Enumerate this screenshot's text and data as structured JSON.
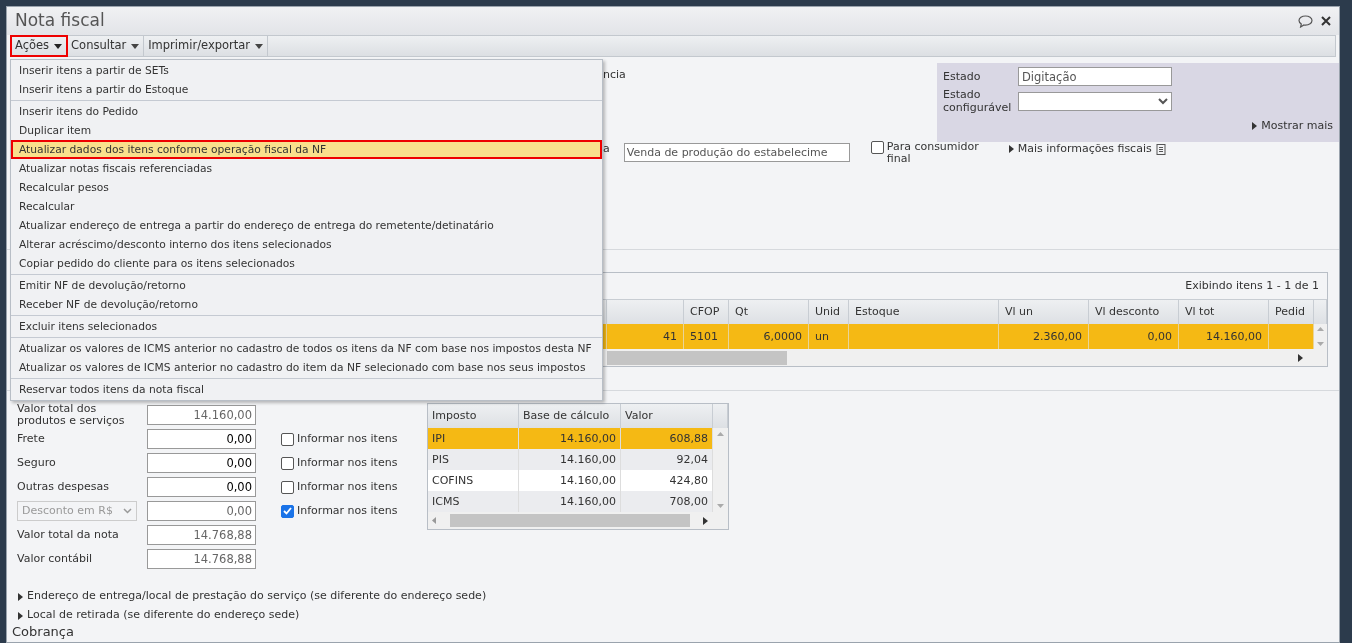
{
  "window": {
    "title": "Nota fiscal"
  },
  "toolbar": [
    {
      "label": "Ações",
      "highlighted": true,
      "expanded": true
    },
    {
      "label": "Consultar",
      "highlighted": false,
      "expanded": false
    },
    {
      "label": "Imprimir/exportar",
      "highlighted": false,
      "expanded": false
    }
  ],
  "menu": {
    "groups": [
      [
        {
          "label": "Inserir itens a partir de SETs",
          "selected": false,
          "highlighted": false
        },
        {
          "label": "Inserir itens a partir do Estoque",
          "selected": false,
          "highlighted": false
        }
      ],
      [
        {
          "label": "Inserir itens do Pedido",
          "selected": false,
          "highlighted": false
        },
        {
          "label": "Duplicar item",
          "selected": false,
          "highlighted": false
        },
        {
          "label": "Atualizar dados dos itens conforme operação fiscal da NF",
          "selected": true,
          "highlighted": true
        },
        {
          "label": "Atualizar notas fiscais referenciadas",
          "selected": false,
          "highlighted": false
        },
        {
          "label": "Recalcular pesos",
          "selected": false,
          "highlighted": false
        },
        {
          "label": "Recalcular",
          "selected": false,
          "highlighted": false
        },
        {
          "label": "Atualizar endereço de entrega a partir do endereço de entrega do remetente/detinatário",
          "selected": false,
          "highlighted": false
        },
        {
          "label": "Alterar acréscimo/desconto interno dos itens selecionados",
          "selected": false,
          "highlighted": false
        },
        {
          "label": "Copiar pedido do cliente para os itens selecionados",
          "selected": false,
          "highlighted": false
        }
      ],
      [
        {
          "label": "Emitir NF de devolução/retorno",
          "selected": false,
          "highlighted": false
        },
        {
          "label": "Receber NF de devolução/retorno",
          "selected": false,
          "highlighted": false
        }
      ],
      [
        {
          "label": "Excluir itens selecionados",
          "selected": false,
          "highlighted": false
        }
      ],
      [
        {
          "label": "Atualizar os valores de ICMS anterior no cadastro de todos os itens da NF com base nos impostos desta NF",
          "selected": false,
          "highlighted": false
        },
        {
          "label": "Atualizar os valores de ICMS anterior no cadastro do item da NF selecionado com base nos seus impostos",
          "selected": false,
          "highlighted": false
        }
      ],
      [
        {
          "label": "Reservar todos itens da nota fiscal",
          "selected": false,
          "highlighted": false
        }
      ]
    ]
  },
  "header": {
    "cut_label": "ncia",
    "status": {
      "label": "Estado",
      "value": "Digitação"
    },
    "configurable_status": {
      "label": "Estado configurável"
    },
    "show_more": "Mostrar mais"
  },
  "operation": {
    "cut_label": "a",
    "value": "Venda de produção do estabelecime",
    "final_consumer": {
      "label": "Para consumidor final",
      "checked": false
    },
    "more_fiscal_info": "Mais informações fiscais"
  },
  "items_grid": {
    "pager": "Exibindo itens 1 - 1 de 1",
    "columns": [
      "CFOP",
      "Qt",
      "Unid",
      "Estoque",
      "Vl un",
      "Vl desconto",
      "Vl tot",
      "Pedid"
    ],
    "rows": [
      {
        "selected": true,
        "cut_cell": "41",
        "cells": [
          "5101",
          "6,0000",
          "un",
          null,
          "2.360,00",
          "0,00",
          "14.160,00",
          null
        ]
      }
    ]
  },
  "totals": [
    {
      "kind": "label",
      "label": "Valor total dos produtos e serviços",
      "value": "14.160,00",
      "readonly": true
    },
    {
      "kind": "label",
      "label": "Frete",
      "value": "0,00",
      "readonly": false,
      "inform": {
        "label": "Informar nos itens",
        "checked": false
      }
    },
    {
      "kind": "label",
      "label": "Seguro",
      "value": "0,00",
      "readonly": false,
      "inform": {
        "label": "Informar nos itens",
        "checked": false
      }
    },
    {
      "kind": "label",
      "label": "Outras despesas",
      "value": "0,00",
      "readonly": false,
      "inform": {
        "label": "Informar nos itens",
        "checked": false
      }
    },
    {
      "kind": "select",
      "label": "Desconto em R$",
      "value": "0,00",
      "readonly": true,
      "inform": {
        "label": "Informar nos itens",
        "checked": true
      }
    },
    {
      "kind": "label",
      "label": "Valor total da nota",
      "value": "14.768,88",
      "readonly": true
    },
    {
      "kind": "label",
      "label": "Valor contábil",
      "value": "14.768,88",
      "readonly": true
    }
  ],
  "taxes": {
    "columns": [
      "Imposto",
      "Base de cálculo",
      "Valor"
    ],
    "rows": [
      {
        "selected": true,
        "cells": [
          "IPI",
          "14.160,00",
          "608,88"
        ]
      },
      {
        "selected": false,
        "cells": [
          "PIS",
          "14.160,00",
          "92,04"
        ]
      },
      {
        "selected": false,
        "cells": [
          "COFINS",
          "14.160,00",
          "424,80"
        ]
      },
      {
        "selected": false,
        "cells": [
          "ICMS",
          "14.160,00",
          "708,00"
        ]
      }
    ]
  },
  "sections": [
    {
      "label": "Endereço de entrega/local de prestação do serviço (se diferente do endereço sede)",
      "expanded": false
    },
    {
      "label": "Local de retirada (se diferente do endereço sede)",
      "expanded": false
    }
  ],
  "next_section": "Cobrança"
}
